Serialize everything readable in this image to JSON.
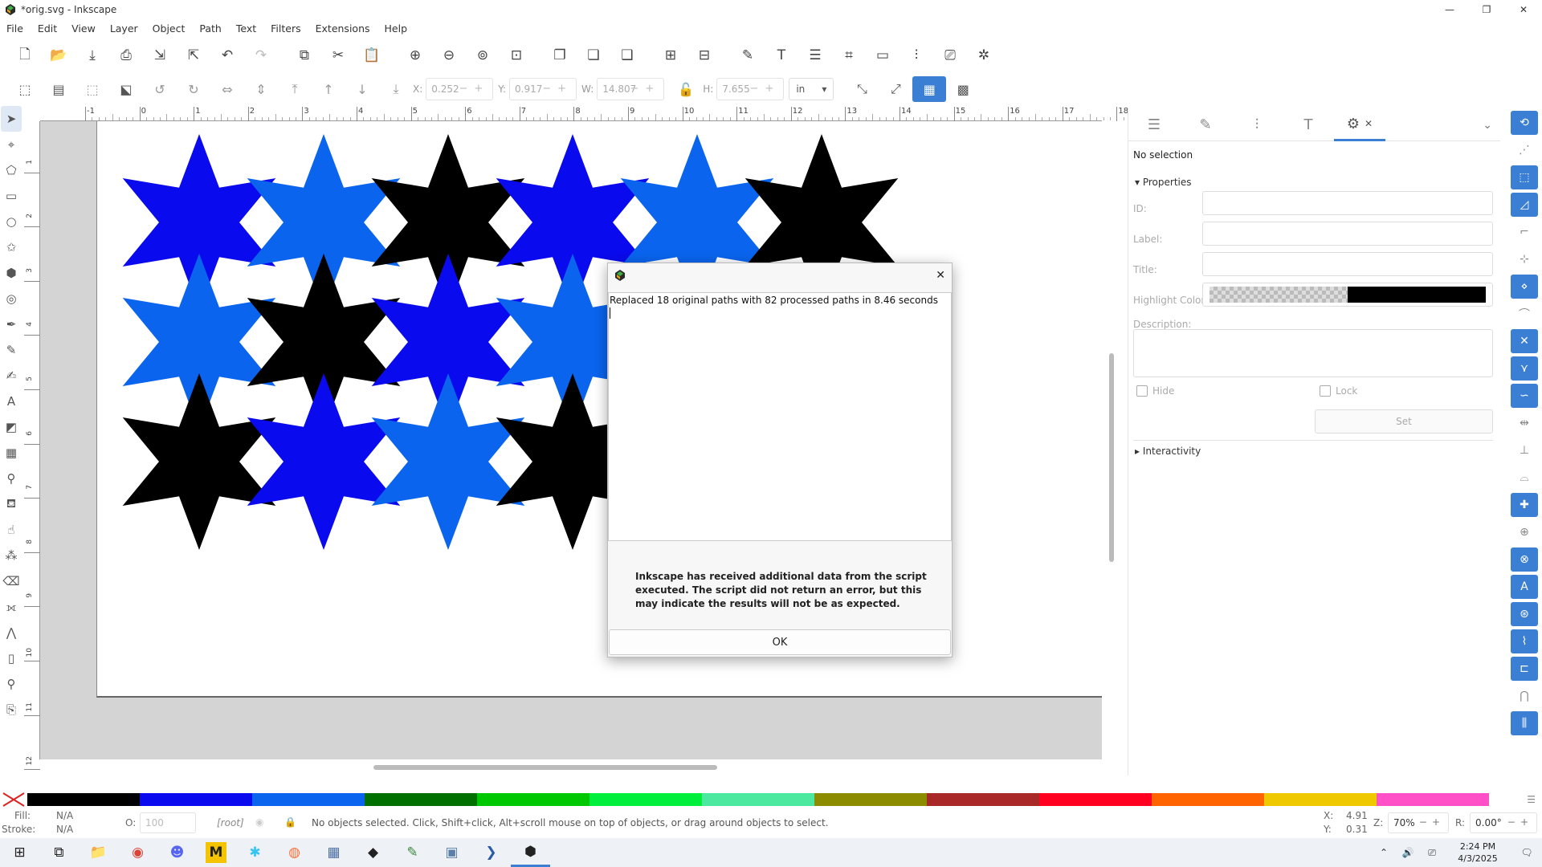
{
  "window": {
    "title": "*orig.svg - Inkscape",
    "minimize": "—",
    "restore": "❐",
    "close": "✕"
  },
  "menu": [
    "File",
    "Edit",
    "View",
    "Layer",
    "Object",
    "Path",
    "Text",
    "Filters",
    "Extensions",
    "Help"
  ],
  "toolbar2": {
    "x_label": "X:",
    "x_value": "0.252",
    "y_label": "Y:",
    "y_value": "0.917",
    "w_label": "W:",
    "w_value": "14.807",
    "h_label": "H:",
    "h_value": "7.655",
    "unit": "in"
  },
  "ruler_ticks": [
    "-1",
    "0",
    "1",
    "2",
    "3",
    "4",
    "5",
    "6",
    "7",
    "8",
    "9",
    "10",
    "11",
    "12",
    "13",
    "14",
    "15",
    "16",
    "17",
    "18"
  ],
  "vruler_ticks": [
    "1",
    "2",
    "3",
    "4",
    "5",
    "6",
    "7",
    "8",
    "9",
    "10",
    "11",
    "12"
  ],
  "colors": {
    "blue": "#0a0aee",
    "light_blue": "#0a64ee",
    "black": "#000000",
    "accent": "#3b7fd4"
  },
  "stars": [
    {
      "row": 0,
      "col": 0,
      "color": "blue"
    },
    {
      "row": 0,
      "col": 1,
      "color": "light_blue"
    },
    {
      "row": 0,
      "col": 2,
      "color": "black"
    },
    {
      "row": 0,
      "col": 3,
      "color": "blue"
    },
    {
      "row": 0,
      "col": 4,
      "color": "light_blue"
    },
    {
      "row": 0,
      "col": 5,
      "color": "black"
    },
    {
      "row": 1,
      "col": 0,
      "color": "light_blue"
    },
    {
      "row": 1,
      "col": 1,
      "color": "black"
    },
    {
      "row": 1,
      "col": 2,
      "color": "blue"
    },
    {
      "row": 1,
      "col": 3,
      "color": "light_blue"
    },
    {
      "row": 2,
      "col": 0,
      "color": "black"
    },
    {
      "row": 2,
      "col": 1,
      "color": "blue"
    },
    {
      "row": 2,
      "col": 2,
      "color": "light_blue"
    },
    {
      "row": 2,
      "col": 3,
      "color": "black"
    }
  ],
  "panel": {
    "no_selection": "No selection",
    "properties": "Properties",
    "id_label": "ID:",
    "label_label": "Label:",
    "title_label": "Title:",
    "highlight_label": "Highlight Color:",
    "description_label": "Description:",
    "hide_label": "Hide",
    "lock_label": "Lock",
    "set_button": "Set",
    "interactivity": "Interactivity"
  },
  "dialog": {
    "output_text": "Replaced 18 original paths with 82 processed paths in 8.46 seconds",
    "message": "Inkscape has received additional data from the script executed. The script did not return an error, but this may indicate the results will not be as expected.",
    "ok": "OK",
    "close": "✕"
  },
  "palette": [
    "#000000",
    "#0a0aee",
    "#0a64ee",
    "#007000",
    "#00c800",
    "#00ee3c",
    "#4ce8a0",
    "#8c8c00",
    "#a82828",
    "#ff0020",
    "#ff6400",
    "#f0c800",
    "#ff50c8"
  ],
  "status": {
    "fill_label": "Fill:",
    "fill_value": "N/A",
    "stroke_label": "Stroke:",
    "stroke_value": "N/A",
    "opacity_label": "O:",
    "opacity_value": "100",
    "layer": "[root]",
    "message": "No objects selected. Click, Shift+click, Alt+scroll mouse on top of objects, or drag around objects to select.",
    "x_label": "X:",
    "x_value": "4.91",
    "y_label": "Y:",
    "y_value": "0.31",
    "zoom_label": "Z:",
    "zoom_value": "70%",
    "rotate_label": "R:",
    "rotate_value": "0.00°"
  },
  "taskbar": {
    "time": "2:24 PM",
    "date": "4/3/2025"
  }
}
